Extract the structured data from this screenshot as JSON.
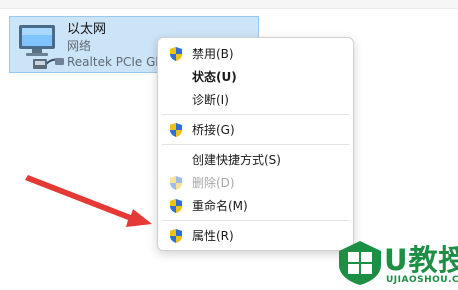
{
  "adapter": {
    "name": "以太网",
    "status": "网络",
    "device": "Realtek PCIe GbE Family Controller"
  },
  "context_menu": {
    "items": [
      {
        "label": "禁用(B)",
        "icon": "uac-shield-icon",
        "enabled": true,
        "bold": false
      },
      {
        "label": "状态(U)",
        "icon": "",
        "enabled": true,
        "bold": true
      },
      {
        "label": "诊断(I)",
        "icon": "",
        "enabled": true,
        "bold": false
      },
      {
        "label": "桥接(G)",
        "icon": "uac-shield-icon",
        "enabled": true,
        "bold": false
      },
      {
        "label": "创建快捷方式(S)",
        "icon": "",
        "enabled": true,
        "bold": false
      },
      {
        "label": "删除(D)",
        "icon": "uac-shield-icon",
        "enabled": false,
        "bold": false
      },
      {
        "label": "重命名(M)",
        "icon": "uac-shield-icon",
        "enabled": true,
        "bold": false
      },
      {
        "label": "属性(R)",
        "icon": "uac-shield-icon",
        "enabled": true,
        "bold": false
      }
    ]
  },
  "annotation": {
    "icon": "red-arrow-icon",
    "color": "#e53935"
  },
  "watermark": {
    "text": "U教授",
    "subtext": "UJIAOSHOU.COM",
    "color": "#1c8f45"
  },
  "colors": {
    "selection": "#cce4f7",
    "selection_border": "#99c9ef"
  }
}
